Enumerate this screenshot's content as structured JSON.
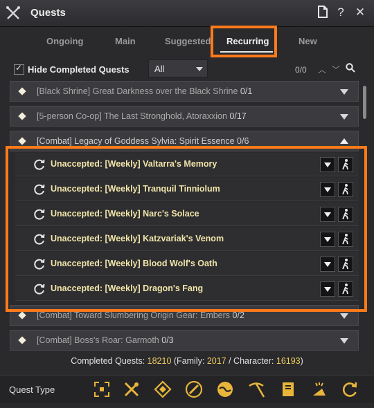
{
  "window": {
    "title": "Quests"
  },
  "tabs": [
    {
      "label": "Ongoing"
    },
    {
      "label": "Main"
    },
    {
      "label": "Suggested"
    },
    {
      "label": "Recurring"
    },
    {
      "label": "New"
    }
  ],
  "filter": {
    "hide_completed_label": "Hide Completed Quests",
    "select_value": "All",
    "page_count": "0/0"
  },
  "quests": [
    {
      "title": "[Black Shrine] Great Darkness over the Black Shrine",
      "count": "0/1"
    },
    {
      "title": "[5-person Co-op] The Last Stronghold, Atoraxxion",
      "count": "0/17"
    },
    {
      "title": "[Combat] Legacy of Goddess Sylvia: Spirit Essence",
      "count": "0/6"
    },
    {
      "title": "[Combat] Toward Slumbering Origin Gear: Embers",
      "count": "0/2"
    },
    {
      "title": "[Combat] Boss's Roar: Garmoth",
      "count": "0/3"
    }
  ],
  "subquests": [
    {
      "label": "Unaccepted: [Weekly] Valtarra's Memory"
    },
    {
      "label": "Unaccepted: [Weekly] Tranquil Tinniolum"
    },
    {
      "label": "Unaccepted: [Weekly] Narc's Solace"
    },
    {
      "label": "Unaccepted: [Weekly] Katzvariak's Venom"
    },
    {
      "label": "Unaccepted: [Weekly] Blood Wolf's Oath"
    },
    {
      "label": "Unaccepted: [Weekly] Dragon's Fang"
    }
  ],
  "completed": {
    "prefix": "Completed Quests: ",
    "total": "18210",
    "family_prefix": " (Family: ",
    "family": "2017",
    "character_prefix": " / Character: ",
    "character": "16193",
    "suffix": ")"
  },
  "quest_type": {
    "label": "Quest Type",
    "icons": [
      "scan-icon",
      "crossed-tools-icon",
      "diamond-target-icon",
      "feather-icon",
      "globe-icon",
      "pickaxe-icon",
      "book-icon",
      "trade-icon",
      "cycle-icon"
    ]
  },
  "colors": {
    "accent": "#ff7a1a",
    "gold": "#f0d060",
    "subquest_text": "#f0e4a8"
  }
}
